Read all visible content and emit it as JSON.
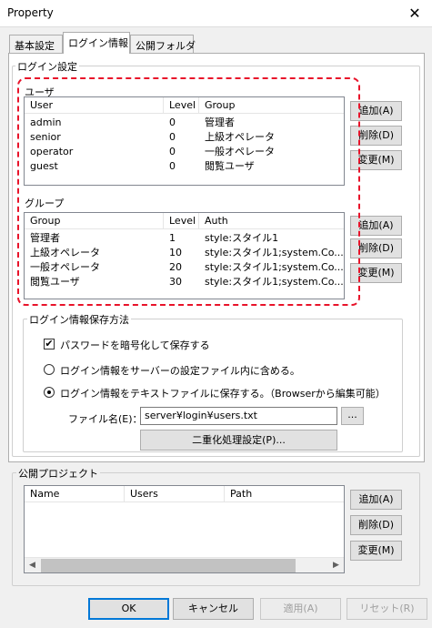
{
  "window": {
    "title": "Property",
    "close_glyph": "✕"
  },
  "tabs": [
    "基本設定",
    "ログイン情報",
    "公開フォルダ"
  ],
  "login_settings": {
    "caption": "ログイン設定",
    "users": {
      "caption": "ユーザ",
      "columns": [
        "User",
        "Level",
        "Group"
      ],
      "rows": [
        [
          "admin",
          "0",
          "管理者"
        ],
        [
          "senior",
          "0",
          "上級オペレータ"
        ],
        [
          "operator",
          "0",
          "一般オペレータ"
        ],
        [
          "guest",
          "0",
          "閲覧ユーザ"
        ]
      ],
      "buttons": {
        "add": "追加(A)",
        "delete": "削除(D)",
        "modify": "変更(M)"
      }
    },
    "groups": {
      "caption": "グループ",
      "columns": [
        "Group",
        "Level",
        "Auth"
      ],
      "rows": [
        [
          "管理者",
          "1",
          "style:スタイル1"
        ],
        [
          "上級オペレータ",
          "10",
          "style:スタイル1;system.Co..."
        ],
        [
          "一般オペレータ",
          "20",
          "style:スタイル1;system.Co..."
        ],
        [
          "閲覧ユーザ",
          "30",
          "style:スタイル1;system.Co..."
        ]
      ],
      "buttons": {
        "add": "追加(A)",
        "delete": "削除(D)",
        "modify": "変更(M)"
      }
    }
  },
  "storage": {
    "caption": "ログイン情報保存方法",
    "encrypt_label": "パスワードを暗号化して保存する",
    "encrypt_checked": true,
    "option_server": "ログイン情報をサーバーの設定ファイル内に含める。",
    "option_text": "ログイン情報をテキストファイルに保存する。（Browserから編集可能）",
    "selected_option": "text",
    "filename_label": "ファイル名(E)：",
    "filename_value": "server¥login¥users.txt",
    "browse_label": "...",
    "dual_button": "二重化処理設定(P)..."
  },
  "public_projects": {
    "caption": "公開プロジェクト",
    "columns": [
      "Name",
      "Users",
      "Path"
    ],
    "buttons": {
      "add": "追加(A)",
      "delete": "削除(D)",
      "modify": "変更(M)"
    }
  },
  "footer": {
    "ok": "OK",
    "cancel": "キャンセル",
    "apply": "適用(A)",
    "reset": "リセット(R)"
  },
  "icons": {
    "checkmark": "✔",
    "arrow_left": "◀",
    "arrow_right": "▶"
  },
  "colors": {
    "highlight_border": "#e8132a",
    "default_button_border": "#0078d7"
  }
}
